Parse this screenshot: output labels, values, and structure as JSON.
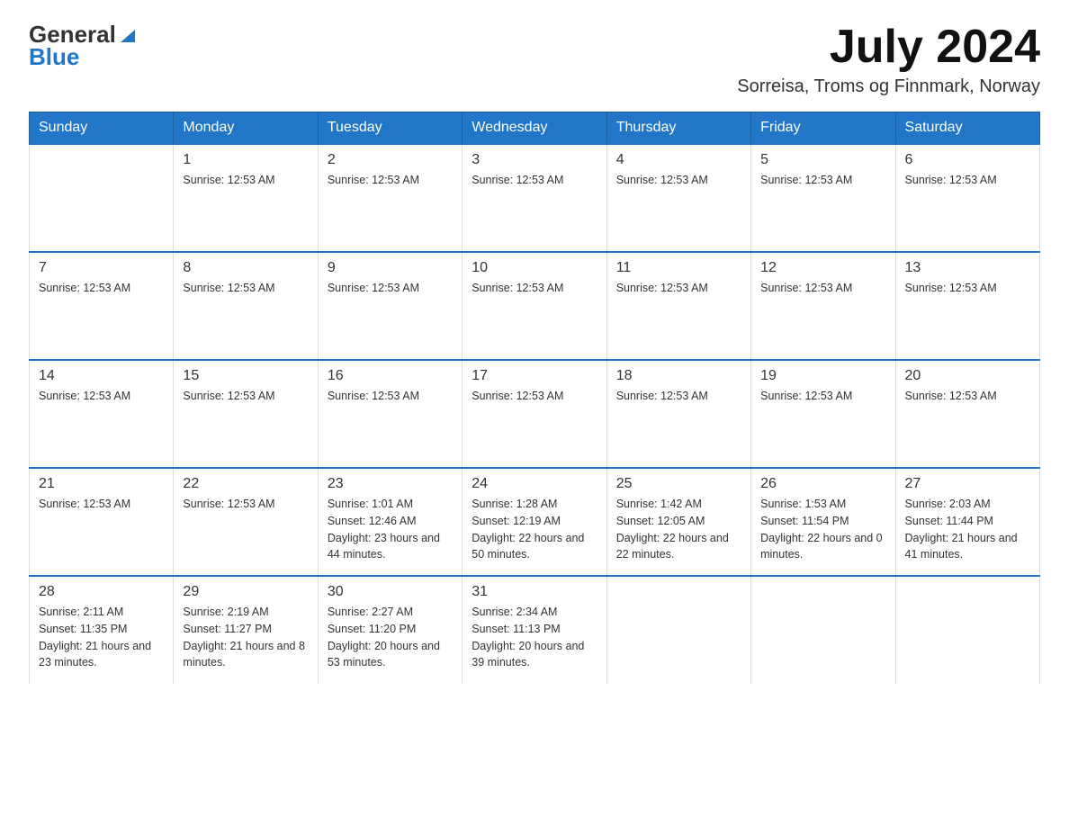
{
  "header": {
    "logo_text_general": "General",
    "logo_text_blue": "Blue",
    "month_title": "July 2024",
    "location": "Sorreisa, Troms og Finnmark, Norway"
  },
  "calendar": {
    "days_of_week": [
      "Sunday",
      "Monday",
      "Tuesday",
      "Wednesday",
      "Thursday",
      "Friday",
      "Saturday"
    ],
    "weeks": [
      [
        {
          "day": "",
          "info": ""
        },
        {
          "day": "1",
          "info": "Sunrise: 12:53 AM"
        },
        {
          "day": "2",
          "info": "Sunrise: 12:53 AM"
        },
        {
          "day": "3",
          "info": "Sunrise: 12:53 AM"
        },
        {
          "day": "4",
          "info": "Sunrise: 12:53 AM"
        },
        {
          "day": "5",
          "info": "Sunrise: 12:53 AM"
        },
        {
          "day": "6",
          "info": "Sunrise: 12:53 AM"
        }
      ],
      [
        {
          "day": "7",
          "info": "Sunrise: 12:53 AM"
        },
        {
          "day": "8",
          "info": "Sunrise: 12:53 AM"
        },
        {
          "day": "9",
          "info": "Sunrise: 12:53 AM"
        },
        {
          "day": "10",
          "info": "Sunrise: 12:53 AM"
        },
        {
          "day": "11",
          "info": "Sunrise: 12:53 AM"
        },
        {
          "day": "12",
          "info": "Sunrise: 12:53 AM"
        },
        {
          "day": "13",
          "info": "Sunrise: 12:53 AM"
        }
      ],
      [
        {
          "day": "14",
          "info": "Sunrise: 12:53 AM"
        },
        {
          "day": "15",
          "info": "Sunrise: 12:53 AM"
        },
        {
          "day": "16",
          "info": "Sunrise: 12:53 AM"
        },
        {
          "day": "17",
          "info": "Sunrise: 12:53 AM"
        },
        {
          "day": "18",
          "info": "Sunrise: 12:53 AM"
        },
        {
          "day": "19",
          "info": "Sunrise: 12:53 AM"
        },
        {
          "day": "20",
          "info": "Sunrise: 12:53 AM"
        }
      ],
      [
        {
          "day": "21",
          "info": "Sunrise: 12:53 AM"
        },
        {
          "day": "22",
          "info": "Sunrise: 12:53 AM"
        },
        {
          "day": "23",
          "info": "Sunrise: 1:01 AM\nSunset: 12:46 AM\nDaylight: 23 hours and 44 minutes."
        },
        {
          "day": "24",
          "info": "Sunrise: 1:28 AM\nSunset: 12:19 AM\nDaylight: 22 hours and 50 minutes."
        },
        {
          "day": "25",
          "info": "Sunrise: 1:42 AM\nSunset: 12:05 AM\nDaylight: 22 hours and 22 minutes."
        },
        {
          "day": "26",
          "info": "Sunrise: 1:53 AM\nSunset: 11:54 PM\nDaylight: 22 hours and 0 minutes."
        },
        {
          "day": "27",
          "info": "Sunrise: 2:03 AM\nSunset: 11:44 PM\nDaylight: 21 hours and 41 minutes."
        }
      ],
      [
        {
          "day": "28",
          "info": "Sunrise: 2:11 AM\nSunset: 11:35 PM\nDaylight: 21 hours and 23 minutes."
        },
        {
          "day": "29",
          "info": "Sunrise: 2:19 AM\nSunset: 11:27 PM\nDaylight: 21 hours and 8 minutes."
        },
        {
          "day": "30",
          "info": "Sunrise: 2:27 AM\nSunset: 11:20 PM\nDaylight: 20 hours and 53 minutes."
        },
        {
          "day": "31",
          "info": "Sunrise: 2:34 AM\nSunset: 11:13 PM\nDaylight: 20 hours and 39 minutes."
        },
        {
          "day": "",
          "info": ""
        },
        {
          "day": "",
          "info": ""
        },
        {
          "day": "",
          "info": ""
        }
      ]
    ]
  }
}
